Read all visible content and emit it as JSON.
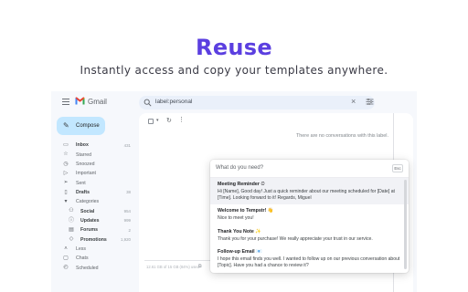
{
  "hero": {
    "title": "Reuse",
    "subtitle": "Instantly access and copy your templates anywhere."
  },
  "gmail": {
    "app_name": "Gmail",
    "search_query": "label:personal",
    "compose_label": "Compose",
    "sidebar": [
      {
        "label": "Inbox",
        "count": "431",
        "icon": "inbox-icon",
        "glyph": "▭"
      },
      {
        "label": "Starred",
        "count": "",
        "icon": "star-icon",
        "glyph": "☆"
      },
      {
        "label": "Snoozed",
        "count": "",
        "icon": "clock-icon",
        "glyph": "◷"
      },
      {
        "label": "Important",
        "count": "",
        "icon": "important-icon",
        "glyph": "▷"
      },
      {
        "label": "Sent",
        "count": "",
        "icon": "send-icon",
        "glyph": "➢"
      },
      {
        "label": "Drafts",
        "count": "38",
        "icon": "draft-icon",
        "glyph": "▯"
      },
      {
        "label": "Categories",
        "count": "",
        "icon": "caret-down-icon",
        "glyph": "▾"
      },
      {
        "label": "Social",
        "count": "954",
        "icon": "people-icon",
        "glyph": "⚇",
        "sub": true
      },
      {
        "label": "Updates",
        "count": "999",
        "icon": "info-icon",
        "glyph": "ⓘ",
        "sub": true
      },
      {
        "label": "Forums",
        "count": "2",
        "icon": "forum-icon",
        "glyph": "▤",
        "sub": true
      },
      {
        "label": "Promotions",
        "count": "1,920",
        "icon": "tag-icon",
        "glyph": "◇",
        "sub": true
      },
      {
        "label": "Less",
        "count": "",
        "icon": "caret-up-icon",
        "glyph": "˄"
      },
      {
        "label": "Chats",
        "count": "",
        "icon": "chat-icon",
        "glyph": "▢"
      },
      {
        "label": "Scheduled",
        "count": "",
        "icon": "schedule-icon",
        "glyph": "◴"
      }
    ],
    "empty_message": "There are no conversations with this label.",
    "storage_text": "12.61 GB of 15 GB (84%) used"
  },
  "popup": {
    "placeholder": "What do you need?",
    "esc_label": "Esc",
    "templates": [
      {
        "title": "Meeting Reminder",
        "emoji": "⏲",
        "body": "Hi [Name], Good day! Just a quick reminder about our meeting scheduled for [Date] at [Time]. Looking forward to it! Regards, Miguel",
        "selected": true
      },
      {
        "title": "Welcome to Tempstr!",
        "emoji": "👋",
        "body": "Nice to meet you!",
        "selected": false
      },
      {
        "title": "Thank You Note",
        "emoji": "✨",
        "body": "Thank you for your purchase! We really appreciate your trust in our service.",
        "selected": false
      },
      {
        "title": "Follow-up Email",
        "emoji": "📧",
        "body": "I hope this email finds you well. I wanted to follow up on our previous conversation about [Topic]. Have you had a chance to review it?",
        "selected": false
      }
    ]
  },
  "colors": {
    "accent": "#5b3fe0",
    "compose_bg": "#c2e7ff",
    "gmail_bg": "#f6f8fc"
  }
}
